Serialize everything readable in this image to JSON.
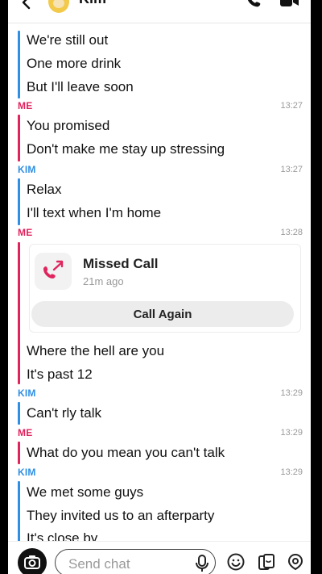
{
  "header": {
    "contact_name": "Kim"
  },
  "conversation": {
    "messages_1": [
      "We're still out",
      "One more drink",
      "But I'll leave soon"
    ],
    "block_2": {
      "sender": "ME",
      "time": "13:27",
      "messages": [
        "You promised",
        "Don't make me stay up stressing"
      ]
    },
    "block_3": {
      "sender": "KIM",
      "time": "13:27",
      "messages": [
        "Relax",
        "I'll text when I'm home"
      ]
    },
    "block_4": {
      "sender": "ME",
      "time": "13:28",
      "missed_call": {
        "title": "Missed Call",
        "subtitle": "21m ago",
        "button": "Call Again"
      },
      "messages": [
        "Where the hell are you",
        "It's past 12"
      ]
    },
    "block_5": {
      "sender": "KIM",
      "time": "13:29",
      "messages": [
        "Can't rly talk"
      ]
    },
    "block_6": {
      "sender": "ME",
      "time": "13:29",
      "messages": [
        "What do you mean you can't talk"
      ]
    },
    "block_7": {
      "sender": "KIM",
      "time": "13:29",
      "messages": [
        "We met some guys",
        "They invited us to an afterparty",
        "It's close by"
      ]
    }
  },
  "composer": {
    "placeholder": "Send chat"
  },
  "colors": {
    "me": "#e0245e",
    "kim": "#2f8fe4"
  },
  "icons": [
    "back-icon",
    "call-icon",
    "video-icon",
    "missed-call-icon",
    "camera-icon",
    "mic-icon",
    "smile-icon",
    "sticker-icon",
    "bitmoji-icon"
  ]
}
